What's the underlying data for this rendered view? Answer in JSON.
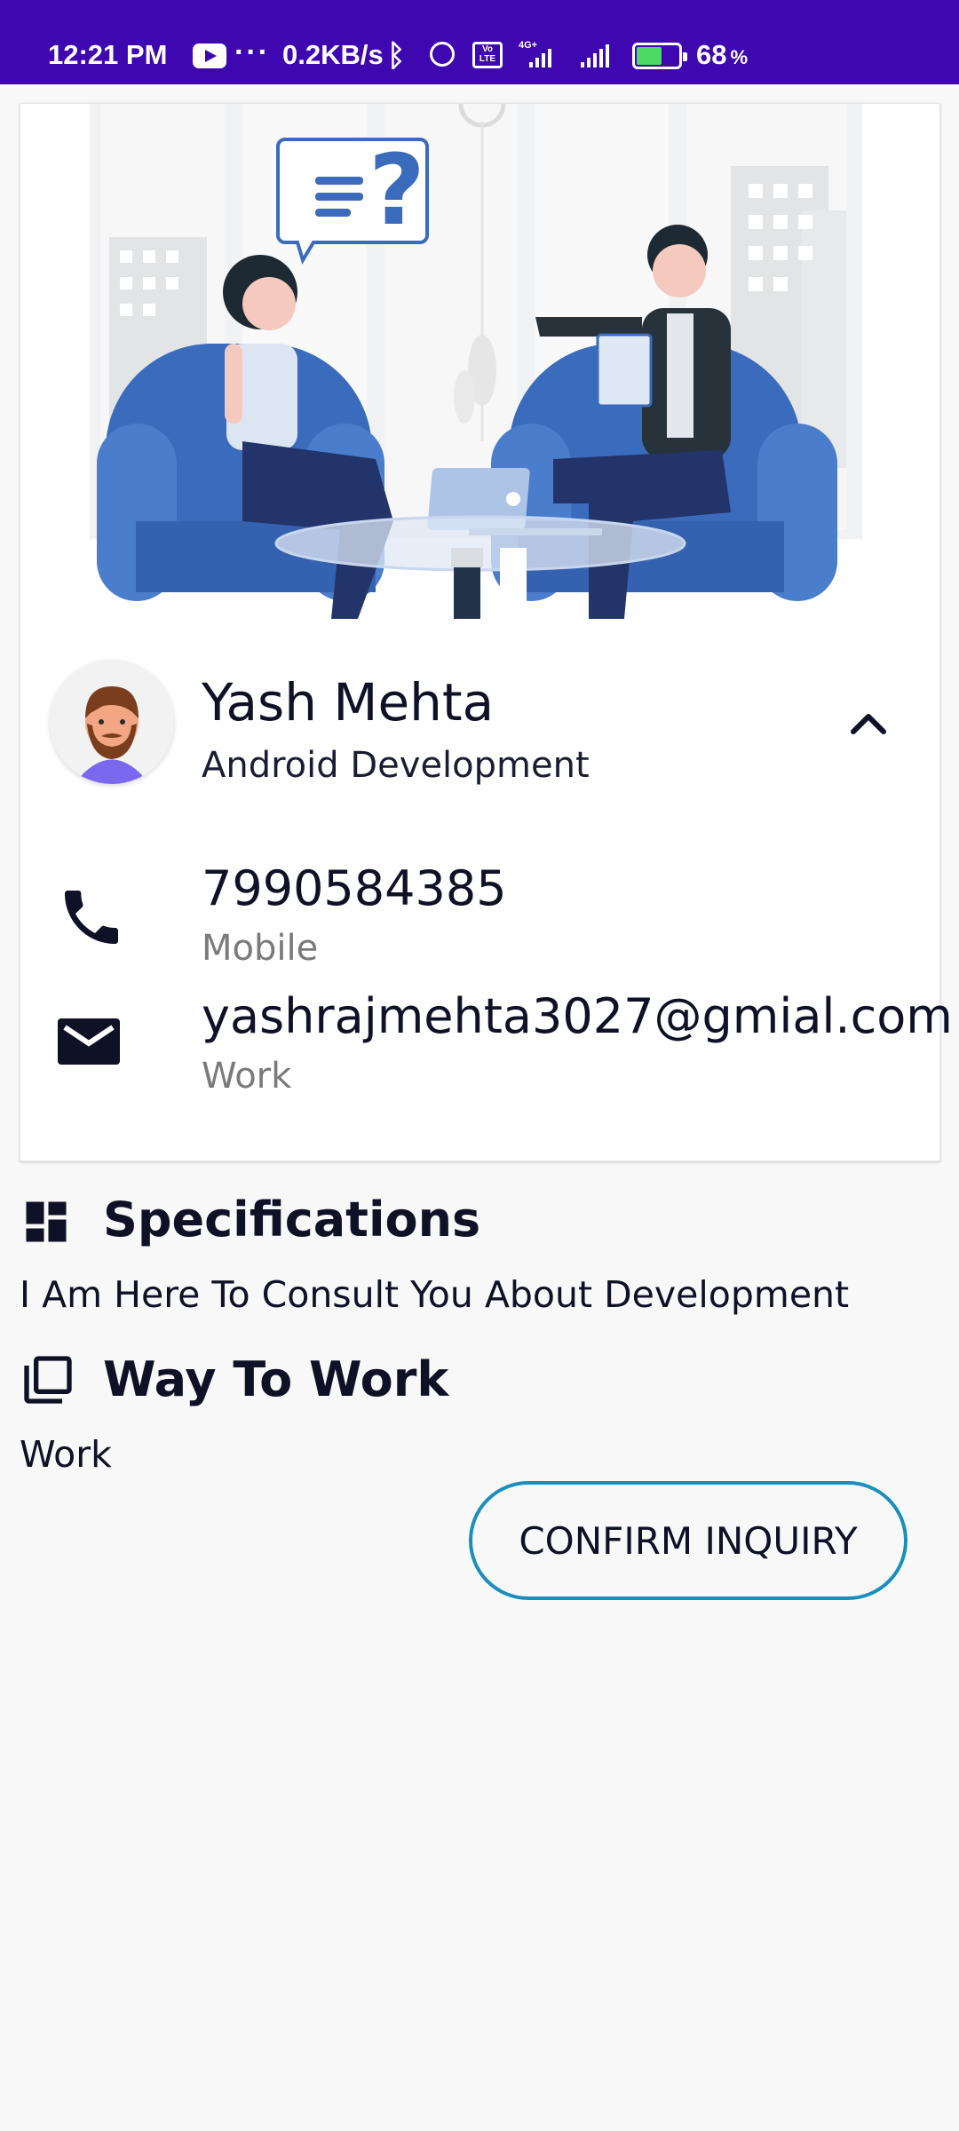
{
  "status_bar": {
    "time": "12:21 PM",
    "speed": "0.2KB/s",
    "battery_percent": "68",
    "battery_unit": "%",
    "network": "4G+",
    "volte": "Vo LTE",
    "icons": [
      "youtube-icon",
      "more-dots-icon",
      "bluetooth-icon",
      "alarm-icon",
      "volte-icon",
      "signal-icon",
      "signal-icon",
      "battery-charging-icon"
    ]
  },
  "profile": {
    "name": "Yash Mehta",
    "role": "Android Development"
  },
  "contacts": [
    {
      "value": "7990584385",
      "type": "Mobile",
      "icon": "phone-icon"
    },
    {
      "value": "yashrajmehta3027@gmial.com",
      "type": "Work",
      "icon": "mail-icon"
    }
  ],
  "specifications": {
    "title": "Specifications",
    "text": "I Am Here To Consult You About Development",
    "icon": "dashboard-icon"
  },
  "way_to_work": {
    "title": "Way To Work",
    "text": "Work",
    "icon": "library-icon"
  },
  "actions": {
    "confirm_label": "CONFIRM INQUIRY"
  },
  "colors": {
    "status_bar": "#3e07b0",
    "button_border": "#1a8fbd",
    "text_primary": "#0f1127",
    "text_secondary": "#7a7a7a",
    "illustration_blue": "#3a6bbd"
  }
}
